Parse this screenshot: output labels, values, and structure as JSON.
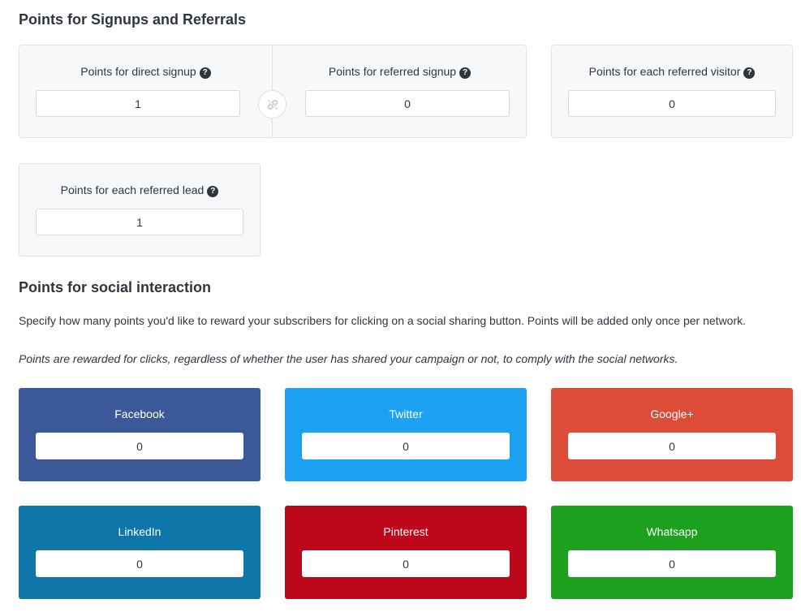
{
  "signups_section": {
    "title": "Points for Signups and Referrals",
    "direct_signup": {
      "label": "Points for direct signup",
      "value": "1"
    },
    "referred_signup": {
      "label": "Points for referred signup",
      "value": "0"
    },
    "referred_visitor": {
      "label": "Points for each referred visitor",
      "value": "0"
    },
    "referred_lead": {
      "label": "Points for each referred lead",
      "value": "1"
    },
    "help_glyph": "?",
    "link_icon": "unlink-icon"
  },
  "social_section": {
    "title": "Points for social interaction",
    "description": "Specify how many points you'd like to reward your subscribers for clicking on a social sharing button. Points will be added only once per network.",
    "note": "Points are rewarded for clicks, regardless of whether the user has shared your campaign or not, to comply with the social networks.",
    "networks": [
      {
        "name": "Facebook",
        "value": "0",
        "color": "#3b5998"
      },
      {
        "name": "Twitter",
        "value": "0",
        "color": "#1da1f2"
      },
      {
        "name": "Google+",
        "value": "0",
        "color": "#dd4b39"
      },
      {
        "name": "LinkedIn",
        "value": "0",
        "color": "#0e76a8"
      },
      {
        "name": "Pinterest",
        "value": "0",
        "color": "#bd081c"
      },
      {
        "name": "Whatsapp",
        "value": "0",
        "color": "#1da01d"
      }
    ]
  }
}
